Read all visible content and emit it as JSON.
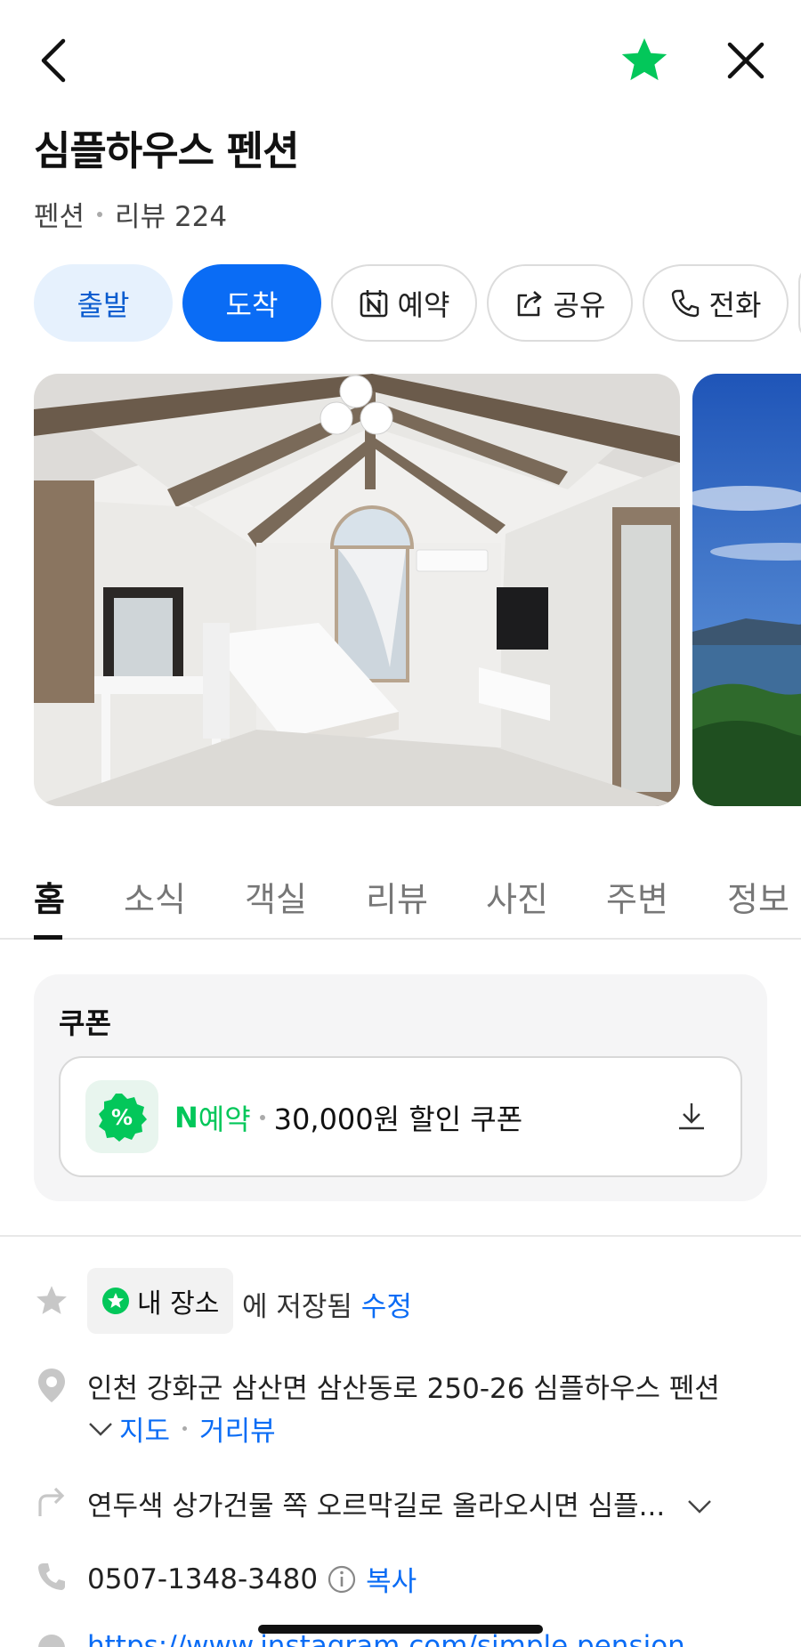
{
  "header": {
    "title": "심플하우스 펜션",
    "category": "펜션",
    "reviews": "리뷰 224"
  },
  "actions": {
    "depart": "출발",
    "arrive": "도착",
    "reserve": "예약",
    "share": "공유",
    "call": "전화"
  },
  "tabs": [
    "홈",
    "소식",
    "객실",
    "리뷰",
    "사진",
    "주변",
    "정보"
  ],
  "coupon": {
    "section_title": "쿠폰",
    "brand_letter": "N",
    "brand_word": "예약",
    "text": "30,000원 할인 쿠폰"
  },
  "saved": {
    "chip_label": "내 장소",
    "text": "에 저장됨",
    "edit": "수정"
  },
  "address": {
    "text": "인천 강화군 삼산면 삼산동로 250-26 심플하우스 펜션",
    "map": "지도",
    "streetview": "거리뷰"
  },
  "directions": {
    "text": "연두색 상가건물 쪽 오르막길로 올라오시면 심플..."
  },
  "phone": {
    "number": "0507-1348-3480",
    "copy": "복사"
  },
  "website": {
    "url": "https://www.instagram.com/simple.pension"
  },
  "colors": {
    "accent_blue": "#0a6cf5",
    "naver_green": "#03c75a",
    "star_green": "#03c75a"
  }
}
